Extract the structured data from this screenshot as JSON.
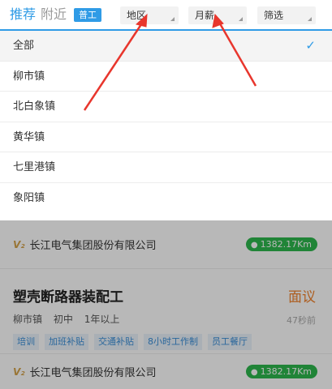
{
  "tabs": {
    "recommend": "推荐",
    "nearby": "附近"
  },
  "badge": "普工",
  "filters": {
    "region": "地区",
    "salary": "月薪",
    "filter": "筛选"
  },
  "dropdown": {
    "items": [
      "全部",
      "柳市镇",
      "北白象镇",
      "黄华镇",
      "七里港镇",
      "象阳镇"
    ],
    "selected_index": 0,
    "check_icon": "✓"
  },
  "listing": {
    "company_top": {
      "icon": "V₂",
      "name": "长江电气集团股份有限公司",
      "distance": "1382.17Km"
    },
    "job": {
      "title": "塑壳断路器装配工",
      "pay": "面议",
      "location": "柳市镇",
      "education": "初中",
      "experience": "1年以上",
      "posted": "47秒前",
      "tags": [
        "培训",
        "加班补贴",
        "交通补贴",
        "8小时工作制",
        "员工餐厅"
      ]
    },
    "company_bottom": {
      "icon": "V₂",
      "name": "长江电气集团股份有限公司",
      "distance": "1382.17Km"
    }
  },
  "colors": {
    "accent": "#2f9be6",
    "pay": "#f0832e",
    "distance_badge": "#2db84d",
    "arrow": "#e8362d"
  }
}
